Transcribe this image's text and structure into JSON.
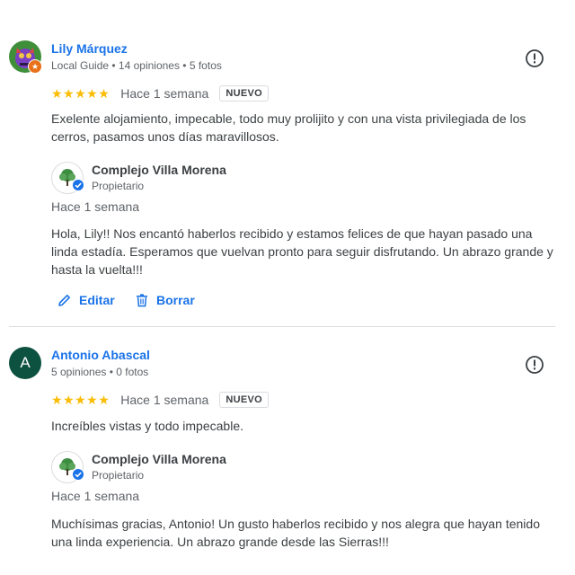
{
  "reviews": [
    {
      "author": "Lily Márquez",
      "meta": "Local Guide • 14 opiniones • 5 fotos",
      "avatar_icon": "illustrated-avatar",
      "stars": "★★★★★",
      "rating": 5,
      "when": "Hace 1 semana",
      "badge": "NUEVO",
      "text": "Exelente alojamiento, impecable, todo muy prolijito y con una vista privilegiada de los cerros, pasamos unos días maravillosos.",
      "reply": {
        "owner": "Complejo Villa Morena",
        "role": "Propietario",
        "when": "Hace 1 semana",
        "text": "Hola, Lily!! Nos encantó haberlos recibido y estamos felices de que hayan pasado una linda estadía. Esperamos que vuelvan pronto para seguir disfrutando. Un abrazo grande y hasta la vuelta!!!"
      },
      "actions": {
        "edit": "Editar",
        "delete": "Borrar"
      }
    },
    {
      "author": "Antonio Abascal",
      "avatar_letter": "A",
      "meta": "5 opiniones • 0 fotos",
      "stars": "★★★★★",
      "rating": 5,
      "when": "Hace 1 semana",
      "badge": "NUEVO",
      "text": "Increíbles vistas y todo impecable.",
      "reply": {
        "owner": "Complejo Villa Morena",
        "role": "Propietario",
        "when": "Hace 1 semana",
        "text": "Muchísimas gracias, Antonio! Un gusto haberlos recibido y nos alegra que hayan tenido una linda experiencia. Un abrazo grande desde las Sierras!!!"
      }
    }
  ],
  "colors": {
    "link": "#1a73e8",
    "star": "#fbbc04",
    "avatar_bg": "#0d5140",
    "guide_badge": "#e8711a",
    "verified": "#1a73e8"
  }
}
